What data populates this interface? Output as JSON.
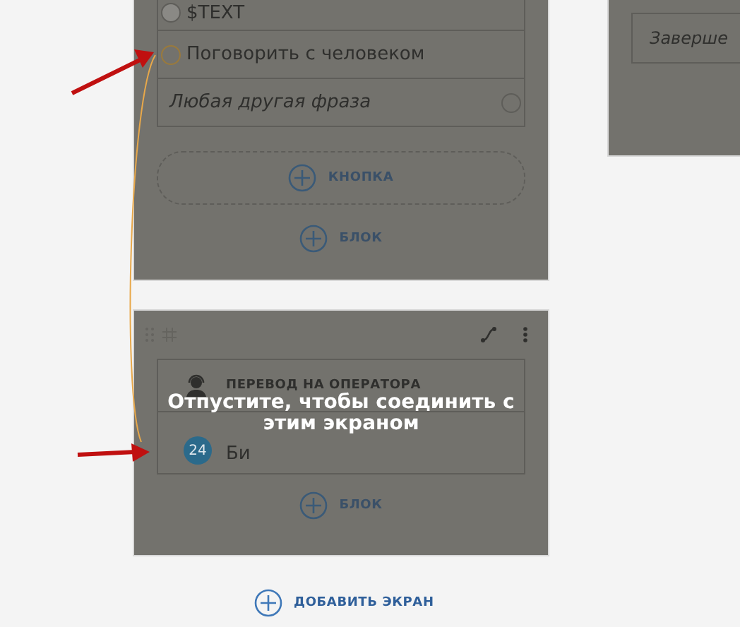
{
  "screens": [
    {
      "kind": "buttons",
      "options": [
        {
          "text": "$TEXT",
          "kind": "filled"
        },
        {
          "text": "Поговорить с человеком",
          "kind": "target"
        },
        {
          "text": "Любая другая фраза",
          "kind": "fallback"
        }
      ],
      "add_button": "КНОПКА",
      "add_block": "БЛОК"
    },
    {
      "kind": "operator",
      "title": "ПЕРЕВОД НА ОПЕРАТОРА",
      "item": {
        "badge": "24",
        "text": "Би"
      },
      "add_block": "БЛОК",
      "drop_hint": "Отпустите, чтобы соединить с этим экраном"
    },
    {
      "kind": "end",
      "button": "Заверше"
    }
  ],
  "add_screen": "ДОБАВИТЬ ЭКРАН"
}
